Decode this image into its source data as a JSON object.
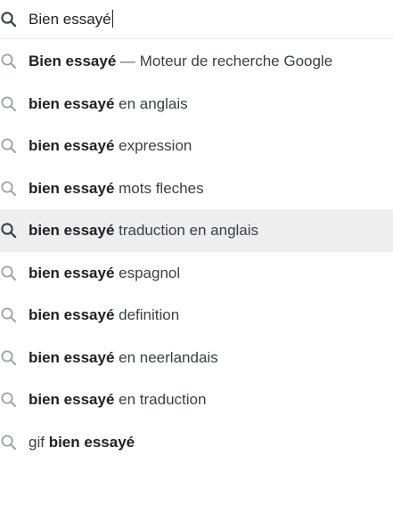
{
  "search": {
    "query": "Bien essayé"
  },
  "colors": {
    "highlight_background": "#eeeeee",
    "icon_muted": "#9aa0a6",
    "icon_active": "#3c4043"
  },
  "icons": {
    "search": "search-icon"
  },
  "suggestions": [
    {
      "bold": "Bien essayé",
      "rest": "Moteur de recherche Google",
      "separator": "—"
    },
    {
      "bold": "bien essayé",
      "rest": "en anglais"
    },
    {
      "bold": "bien essayé",
      "rest": "expression"
    },
    {
      "bold": "bien essayé",
      "rest": "mots fleches"
    },
    {
      "bold": "bien essayé",
      "rest": "traduction en anglais",
      "highlighted": true
    },
    {
      "bold": "bien essayé",
      "rest": "espagnol"
    },
    {
      "bold": "bien essayé",
      "rest": "definition"
    },
    {
      "bold": "bien essayé",
      "rest": "en neerlandais"
    },
    {
      "bold": "bien essayé",
      "rest": "en traduction"
    },
    {
      "prefix": "gif",
      "bold": "bien essayé"
    }
  ]
}
